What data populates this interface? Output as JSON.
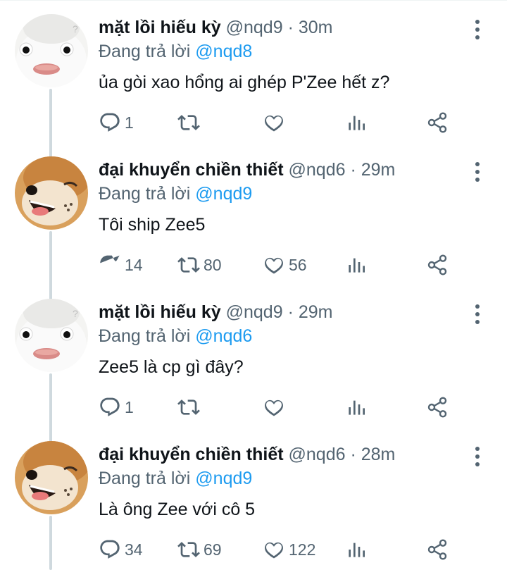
{
  "tweets": [
    {
      "author": "mặt lồi hiếu kỳ",
      "handle": "@nqd9",
      "separator": "·",
      "time": "30m",
      "replying_prefix": "Đang trả lời",
      "replying_to": "@nqd8",
      "text": "ủa gòi xao hổng ai ghép P'Zee hết z?",
      "replies": "1",
      "retweets": "",
      "likes": "",
      "avatar_icon": "white-creature-avatar"
    },
    {
      "author": "đại khuyển chiền thiết",
      "handle": "@nqd6",
      "separator": "·",
      "time": "29m",
      "replying_prefix": "Đang trả lời",
      "replying_to": "@nqd9",
      "text": "Tôi ship Zee5",
      "replies": "14",
      "retweets": "80",
      "likes": "56",
      "avatar_icon": "shiba-dog-avatar"
    },
    {
      "author": "mặt lồi hiếu kỳ",
      "handle": "@nqd9",
      "separator": "·",
      "time": "29m",
      "replying_prefix": "Đang trả lời",
      "replying_to": "@nqd6",
      "text": "Zee5 là cp gì đây?",
      "replies": "1",
      "retweets": "",
      "likes": "",
      "avatar_icon": "white-creature-avatar"
    },
    {
      "author": "đại khuyển chiền thiết",
      "handle": "@nqd6",
      "separator": "·",
      "time": "28m",
      "replying_prefix": "Đang trả lời",
      "replying_to": "@nqd9",
      "text": "Là ông Zee với cô 5",
      "replies": "34",
      "retweets": "69",
      "likes": "122",
      "avatar_icon": "shiba-dog-avatar"
    }
  ],
  "colors": {
    "text": "#0f1419",
    "secondary": "#536471",
    "mention": "#1d9bf0",
    "thread_line": "#cfd9de"
  },
  "icons": [
    "reply-icon",
    "retweet-icon",
    "like-icon",
    "view-stats-icon",
    "share-icon",
    "more-options-icon"
  ]
}
